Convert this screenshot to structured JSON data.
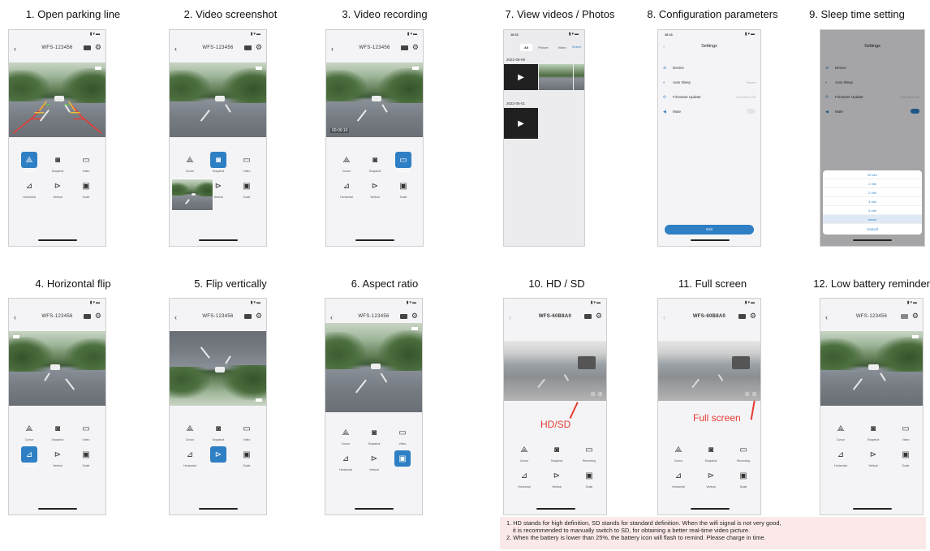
{
  "panels": [
    {
      "id": "p1",
      "title": "1. Open parking line",
      "device": "WFS-123456",
      "mode": "parking",
      "active": "cursor"
    },
    {
      "id": "p2",
      "title": "2. Video screenshot",
      "device": "WFS-123456",
      "mode": "screenshot",
      "active": "snapshot"
    },
    {
      "id": "p3",
      "title": "3. Video recording",
      "device": "WFS-123456",
      "mode": "recording",
      "active": "video",
      "rec_time": "00:00:10"
    },
    {
      "id": "p7",
      "title": "7. View videos / Photos"
    },
    {
      "id": "p8",
      "title": "8. Configuration parameters"
    },
    {
      "id": "p9",
      "title": "9. Sleep time setting"
    },
    {
      "id": "p4",
      "title": "4. Horizontal flip",
      "device": "WFS-123456",
      "mode": "normal",
      "active": "horizontal"
    },
    {
      "id": "p5",
      "title": "5. Flip vertically",
      "device": "WFS-123456",
      "mode": "vflip",
      "active": "vertical"
    },
    {
      "id": "p6",
      "title": "6. Aspect ratio",
      "device": "WFS-123456",
      "mode": "ratio",
      "active": "scale"
    },
    {
      "id": "p10",
      "title": "10. HD / SD",
      "device": "WFS-60B8A0",
      "mode": "gray",
      "callout": "HD/SD"
    },
    {
      "id": "p11",
      "title": "11. Full screen",
      "device": "WFS-60B8A0",
      "mode": "gray",
      "callout": "Full screen"
    },
    {
      "id": "p12",
      "title": "12. Low battery reminder",
      "device": "WFS-123456",
      "mode": "normal"
    }
  ],
  "controls": {
    "cursor": "Cursor",
    "snapshot": "Snapshot",
    "video": "Video",
    "recording": "Recording",
    "horizontal": "Horizontal",
    "vertical": "Vertical",
    "scale": "Scale"
  },
  "gallery": {
    "time": "16:11",
    "tabs": [
      "All",
      "Picture",
      "Video"
    ],
    "select": "Select",
    "dates": [
      "2022-06-09",
      "2022-06-01"
    ]
  },
  "settings": {
    "time": "16:11",
    "title": "Settings",
    "rows": [
      {
        "icon": "wifi-icon",
        "label": "Device",
        "value": ""
      },
      {
        "icon": "moon-icon",
        "label": "Auto Sleep",
        "value": "Never"
      },
      {
        "icon": "update-icon",
        "label": "Firmware Update",
        "value": "v.22.06.01.00"
      },
      {
        "icon": "speaker-icon",
        "label": "Mute",
        "value": ""
      }
    ],
    "exit": "Exit"
  },
  "sleep": {
    "title": "Settings",
    "options": [
      "30 sec",
      "1 min",
      "2 min",
      "3 min",
      "4 min",
      "Never"
    ],
    "cancel": "Cancel"
  },
  "notes": [
    "1. HD stands for high definition, SD stands for standard definition. When the wifi signal is not very good,",
    "   it is recommended to manually switch to SD, for obtaining a better real-time video picture.",
    "2. When the battery is lower than 25%, the battery icon will flash to remind. Please charge in time."
  ],
  "colors": {
    "accent": "#2f7fc4",
    "callout": "#e63b32",
    "note_bg": "#fbe9ea"
  }
}
